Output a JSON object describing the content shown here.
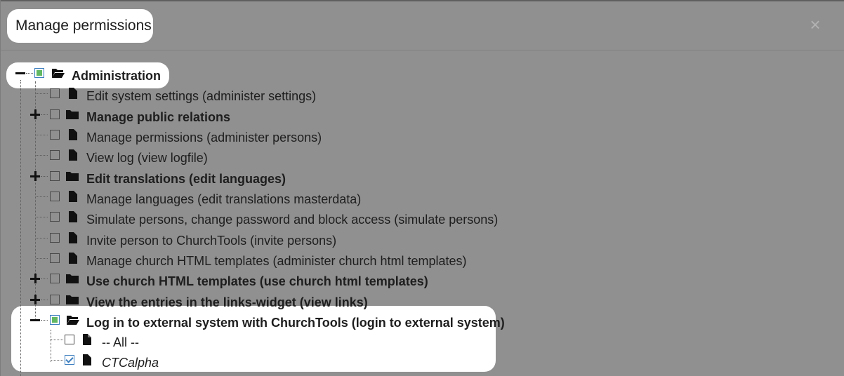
{
  "dialog": {
    "title": "Manage permissions",
    "close_glyph": "×"
  },
  "tree": {
    "root": {
      "label": "Administration",
      "state": "partial",
      "expanded": true,
      "icon": "folder-open-icon"
    },
    "items": [
      {
        "label": "Edit system settings (administer settings)",
        "type": "file",
        "checkbox": "unchecked"
      },
      {
        "label": "Manage public relations",
        "type": "folder",
        "checkbox": "unchecked",
        "expander": "plus"
      },
      {
        "label": "Manage permissions (administer persons)",
        "type": "file",
        "checkbox": "unchecked"
      },
      {
        "label": "View log (view logfile)",
        "type": "file",
        "checkbox": "unchecked"
      },
      {
        "label": "Edit translations (edit languages)",
        "type": "folder",
        "checkbox": "unchecked",
        "expander": "plus"
      },
      {
        "label": "Manage languages (edit translations masterdata)",
        "type": "file",
        "checkbox": "unchecked"
      },
      {
        "label": "Simulate persons, change password and block access (simulate persons)",
        "type": "file",
        "checkbox": "unchecked"
      },
      {
        "label": "Invite person to ChurchTools (invite persons)",
        "type": "file",
        "checkbox": "unchecked"
      },
      {
        "label": "Manage church HTML templates (administer church html templates)",
        "type": "file",
        "checkbox": "unchecked"
      },
      {
        "label": "Use church HTML templates (use church html templates)",
        "type": "folder",
        "checkbox": "unchecked",
        "expander": "plus"
      },
      {
        "label": "View the entries in the links-widget (view links)",
        "type": "folder",
        "checkbox": "unchecked",
        "expander": "plus"
      },
      {
        "label": "Log in to external system with ChurchTools (login to external system)",
        "type": "folder-open",
        "checkbox": "partial",
        "expander": "minus"
      }
    ],
    "login_children": [
      {
        "label": "-- All --",
        "checkbox": "unchecked"
      },
      {
        "label": "CTCalpha",
        "checkbox": "checked"
      }
    ]
  },
  "colors": {
    "overlay": "#909090",
    "highlight": "#ffffff",
    "partial_fill": "#62b862",
    "check_blue": "#3c7ebf"
  }
}
